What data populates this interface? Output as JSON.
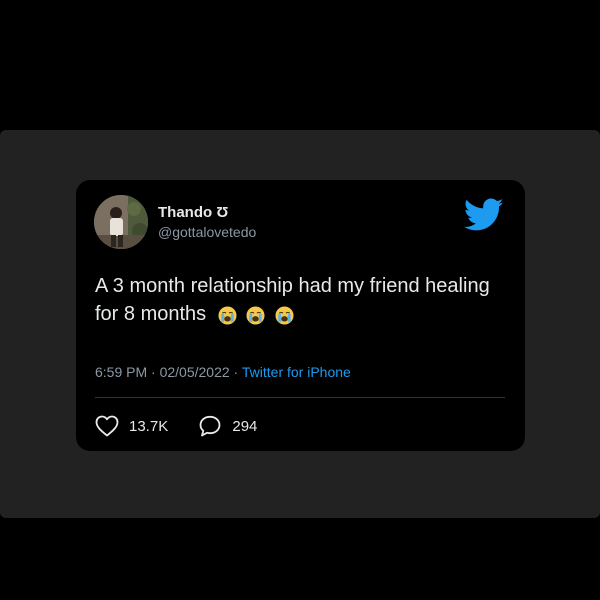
{
  "tweet": {
    "author": {
      "name": "Thando Ʊ",
      "handle": "@gottalovetedo"
    },
    "text": "A 3 month relationship had my friend healing for 8 months",
    "emojis": [
      "loudly-crying-face-icon",
      "loudly-crying-face-icon",
      "loudly-crying-face-icon"
    ],
    "time": "6:59 PM",
    "separator1": " · ",
    "date": "02/05/2022",
    "separator2": " · ",
    "source": "Twitter for iPhone",
    "likes": "13.7K",
    "replies": "294"
  },
  "colors": {
    "background": "#000000",
    "frame": "#222222",
    "card": "#000000",
    "text_primary": "#e7e9ea",
    "text_secondary": "#8b98a5",
    "accent": "#1d9bf0"
  },
  "icons": {
    "brand": "twitter-bird-icon",
    "like": "heart-outline-icon",
    "reply": "speech-bubble-icon"
  }
}
